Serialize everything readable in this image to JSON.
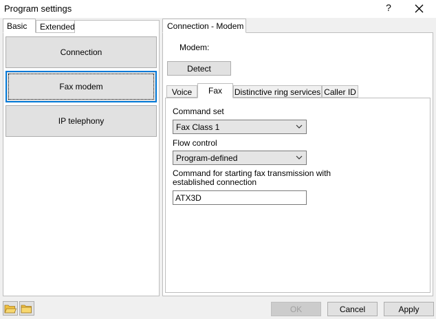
{
  "window": {
    "title": "Program settings",
    "help_glyph": "?",
    "close_glyph": "✕"
  },
  "left_tabs": {
    "basic": "Basic",
    "extended": "Extended"
  },
  "categories": {
    "connection": "Connection",
    "fax_modem": "Fax modem",
    "ip_telephony": "IP telephony"
  },
  "right": {
    "tab_label": "Connection - Modem",
    "modem_label": "Modem:",
    "detect_label": "Detect"
  },
  "inner_tabs": {
    "voice": "Voice",
    "fax": "Fax",
    "distinctive_ring": "Distinctive ring services",
    "caller_id": "Caller ID"
  },
  "fax": {
    "command_set_label": "Command set",
    "command_set_value": "Fax Class 1",
    "flow_control_label": "Flow control",
    "flow_control_value": "Program-defined",
    "start_command_label": "Command for starting fax transmission with established connection",
    "start_command_value": "ATX3D"
  },
  "buttons": {
    "ok": "OK",
    "cancel": "Cancel",
    "apply": "Apply"
  },
  "colors": {
    "focus_border": "#0078d7",
    "folder_icon": "#f0c040"
  }
}
